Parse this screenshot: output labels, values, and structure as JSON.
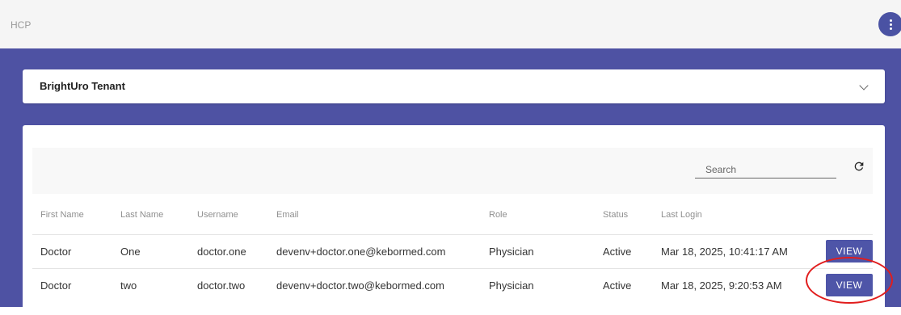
{
  "app": {
    "title": "HCP"
  },
  "tenant": {
    "name": "BrightUro Tenant"
  },
  "search": {
    "placeholder": "Search"
  },
  "table": {
    "columns": [
      "First Name",
      "Last Name",
      "Username",
      "Email",
      "Role",
      "Status",
      "Last Login"
    ],
    "rows": [
      {
        "first_name": "Doctor",
        "last_name": "One",
        "username": "doctor.one",
        "email": "devenv+doctor.one@kebormed.com",
        "role": "Physician",
        "status": "Active",
        "last_login": "Mar 18, 2025, 10:41:17 AM",
        "action": "VIEW"
      },
      {
        "first_name": "Doctor",
        "last_name": "two",
        "username": "doctor.two",
        "email": "devenv+doctor.two@kebormed.com",
        "role": "Physician",
        "status": "Active",
        "last_login": "Mar 18, 2025, 9:20:53 AM",
        "action": "VIEW"
      }
    ]
  },
  "colors": {
    "accent": "#4e52a3",
    "highlight": "#e11d1d"
  },
  "icons": {
    "menu": "more-vert-icon",
    "dropdown": "chevron-down-icon",
    "refresh": "refresh-icon"
  }
}
